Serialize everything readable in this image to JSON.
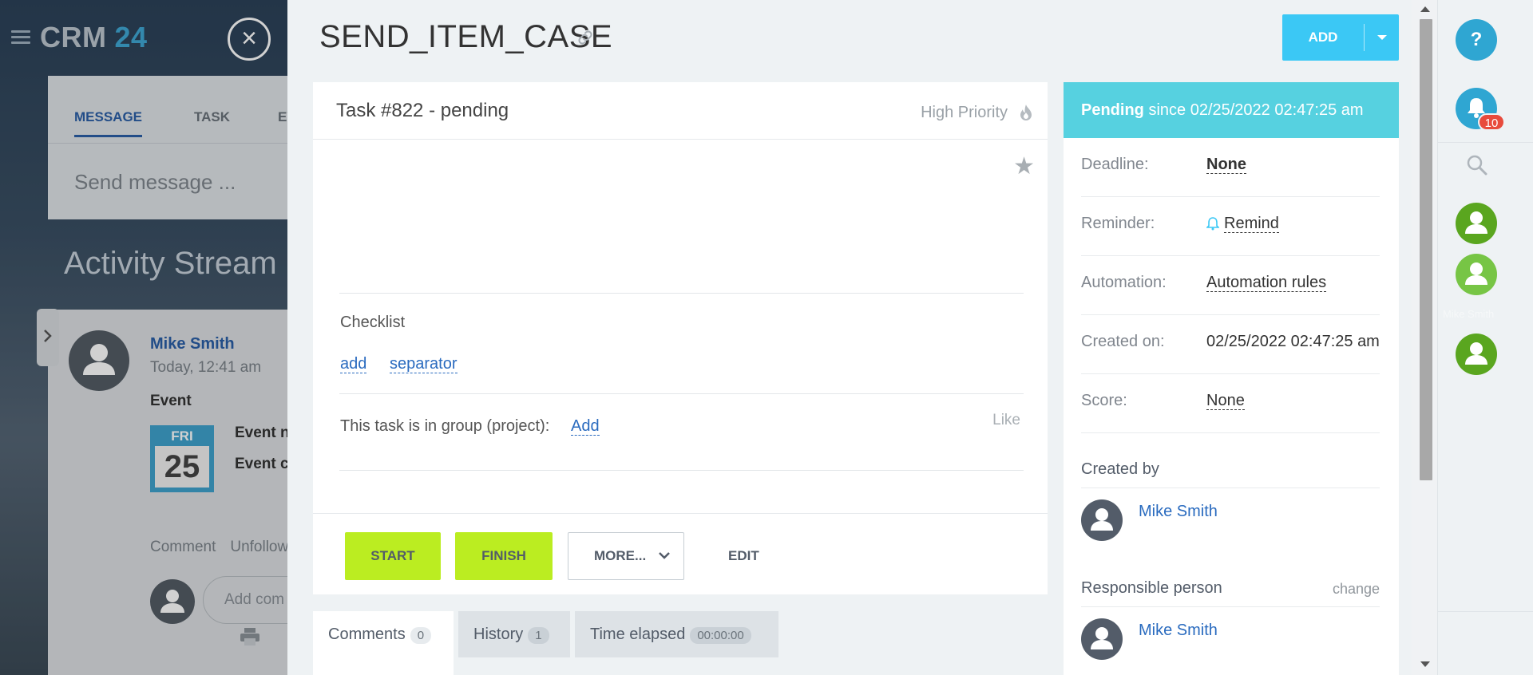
{
  "background": {
    "brand": "CRM",
    "brand_num": "24",
    "composer": {
      "tabs": [
        "MESSAGE",
        "TASK",
        "EV"
      ],
      "placeholder": "Send message ..."
    },
    "stream_title": "Activity Stream",
    "post": {
      "author": "Mike Smith",
      "time": "Today, 12:41 am",
      "type": "Event",
      "cal_day": "FRI",
      "cal_date": "25",
      "event_line1": "Event n",
      "event_line2": "Event c",
      "actions": [
        "Comment",
        "Unfollow"
      ],
      "comment_placeholder": "Add com"
    }
  },
  "panel": {
    "title": "SEND_ITEM_CASE",
    "add_label": "ADD",
    "task": {
      "title": "Task #822 - pending",
      "priority": "High Priority",
      "checklist_title": "Checklist",
      "checklist_add": "add",
      "checklist_separator": "separator",
      "group_text": "This task is in group (project):",
      "group_add": "Add",
      "like": "Like"
    },
    "buttons": {
      "start": "START",
      "finish": "FINISH",
      "more": "MORE...",
      "edit": "EDIT"
    },
    "tabs": [
      {
        "label": "Comments",
        "count": "0"
      },
      {
        "label": "History",
        "count": "1"
      },
      {
        "label": "Time elapsed",
        "count": "00:00:00"
      }
    ],
    "sidebar": {
      "status_bold": "Pending",
      "status_rest": "since 02/25/2022 02:47:25 am",
      "rows": [
        {
          "key": "Deadline:",
          "value": "None"
        },
        {
          "key": "Reminder:",
          "value": "Remind"
        },
        {
          "key": "Automation:",
          "value": "Automation rules"
        },
        {
          "key": "Created on:",
          "value": "02/25/2022 02:47:25 am"
        },
        {
          "key": "Score:",
          "value": "None"
        }
      ],
      "created_by_title": "Created by",
      "created_by": "Mike Smith",
      "responsible_title": "Responsible person",
      "responsible_change": "change",
      "responsible": "Mike Smith"
    }
  },
  "rail": {
    "help": "?",
    "notifications": "10",
    "ghost_text": "Mike Smith"
  },
  "colors": {
    "accent_blue": "#3bc8f5",
    "status_cyan": "#56d1e0",
    "green_button": "#bbed21",
    "link_blue": "#2a6bbf",
    "badge_red": "#e84b3c",
    "avatar_green": "#5aa61f"
  },
  "icons": [
    "menu-icon",
    "close-icon",
    "link-icon",
    "chevron-down-icon",
    "flame-icon",
    "star-icon",
    "bell-icon",
    "search-icon",
    "user-icon",
    "printer-icon",
    "chevron-right-icon"
  ]
}
